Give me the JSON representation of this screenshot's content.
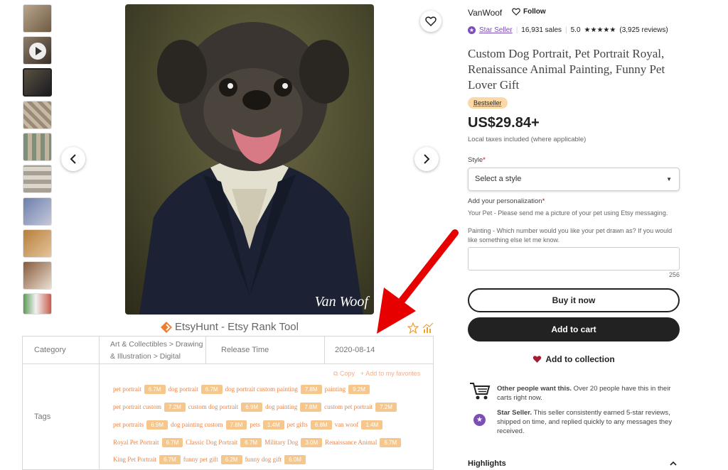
{
  "shop": {
    "name": "VanWoof",
    "follow": "Follow",
    "star_seller": "Star Seller",
    "sales": "16,931 sales",
    "rating": "5.0",
    "stars": "★★★★★",
    "reviews": "(3,925 reviews)"
  },
  "product": {
    "title": "Custom Dog Portrait, Pet Portrait Royal, Renaissance Animal Painting, Funny Pet Lover Gift",
    "badge": "Bestseller",
    "price": "US$29.84+",
    "tax_note": "Local taxes included (where applicable)"
  },
  "style": {
    "label": "Style",
    "required": "*",
    "placeholder": "Select a style"
  },
  "personalization": {
    "label": "Add your personalization",
    "required": "*",
    "note": "Your Pet - Please send me a picture of your pet using Etsy messaging.",
    "question": "Painting - Which number would you like your pet drawn as? If you would like something else let me know.",
    "char_count": "256"
  },
  "actions": {
    "buy_now": "Buy it now",
    "add_to_cart": "Add to cart",
    "add_to_collection": "Add to collection"
  },
  "info": {
    "demand_title": "Other people want this.",
    "demand_text": " Over 20 people have this in their carts right now.",
    "seller_title": "Star Seller.",
    "seller_text": " This seller consistently earned 5-star reviews, shipped on time, and replied quickly to any messages they received."
  },
  "highlights": "Highlights",
  "watermark": "Van Woof",
  "etsyhunt": {
    "title": "EtsyHunt - Etsy Rank Tool",
    "category_label": "Category",
    "category_value": "Art & Collectibles > Drawing & Illustration > Digital",
    "release_label": "Release Time",
    "release_value": "2020-08-14",
    "tags_label": "Tags",
    "copy": "Copy",
    "add_fav": "+ Add to my favorites",
    "tag_rows": [
      [
        {
          "name": "pet portrait",
          "val": "6.7M"
        },
        {
          "name": "dog portrait",
          "val": "6.7M"
        },
        {
          "name": "dog portrait custom painting",
          "val": "7.8M"
        },
        {
          "name": "painting",
          "val": "9.2M"
        }
      ],
      [
        {
          "name": "pet portrait custom",
          "val": "7.2M"
        },
        {
          "name": "custom dog portrait",
          "val": "6.9M"
        },
        {
          "name": "dog painting",
          "val": "7.8M"
        },
        {
          "name": "custom pet portrait",
          "val": "7.2M"
        }
      ],
      [
        {
          "name": "pet portraits",
          "val": "6.9M"
        },
        {
          "name": "dog painting custom",
          "val": "7.8M"
        },
        {
          "name": "pets",
          "val": "1.4M"
        },
        {
          "name": "pet gifts",
          "val": "6.8M"
        },
        {
          "name": "van woof",
          "val": "1.4M"
        }
      ],
      [
        {
          "name": "Royal Pet Portrait",
          "val": "6.7M"
        },
        {
          "name": "Classic Dog Portrait",
          "val": "6.7M"
        },
        {
          "name": "Military Dog",
          "val": "3.0M"
        },
        {
          "name": "Renaissance Animal",
          "val": "6.7M"
        }
      ],
      [
        {
          "name": "King Pet Portrait",
          "val": "6.7M"
        },
        {
          "name": "funny pet gift",
          "val": "6.2M"
        },
        {
          "name": "funny dog gift",
          "val": "6.0M"
        }
      ]
    ]
  },
  "colors": {
    "accent_red": "#e60000",
    "star_seller": "#7b4fb6",
    "badge_bg": "#fcd8a7",
    "dark_button": "#222222",
    "tag_orange": "#e8864a"
  }
}
